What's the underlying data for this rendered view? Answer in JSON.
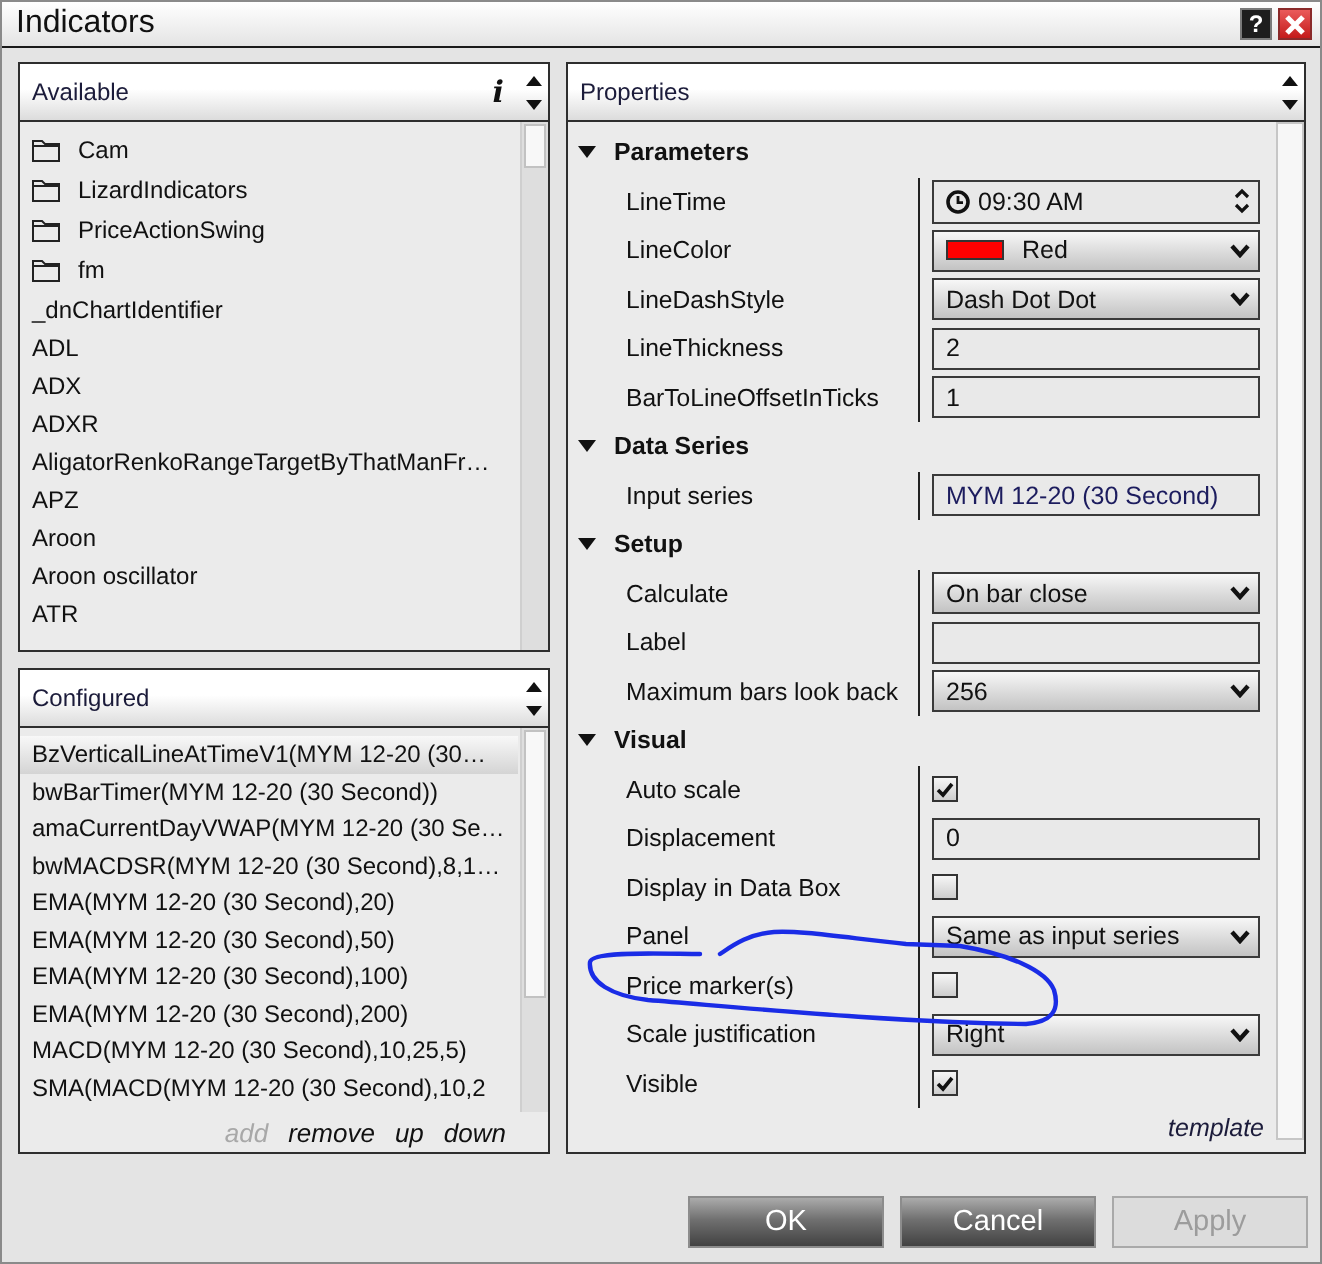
{
  "window": {
    "title": "Indicators",
    "help_button": "?"
  },
  "available": {
    "title": "Available",
    "info_button": "i",
    "items": [
      {
        "kind": "folder",
        "label": "Cam",
        "selected": false
      },
      {
        "kind": "folder",
        "label": "LizardIndicators",
        "selected": false
      },
      {
        "kind": "folder",
        "label": "PriceActionSwing",
        "selected": false
      },
      {
        "kind": "folder",
        "label": "fm",
        "selected": false
      },
      {
        "kind": "indicator",
        "label": "_dnChartIdentifier",
        "selected": false
      },
      {
        "kind": "indicator",
        "label": "ADL",
        "selected": false
      },
      {
        "kind": "indicator",
        "label": "ADX",
        "selected": false
      },
      {
        "kind": "indicator",
        "label": "ADXR",
        "selected": false
      },
      {
        "kind": "indicator",
        "label": "AligatorRenkoRangeTargetByThatManFr…",
        "selected": false
      },
      {
        "kind": "indicator",
        "label": "APZ",
        "selected": false
      },
      {
        "kind": "indicator",
        "label": "Aroon",
        "selected": false
      },
      {
        "kind": "indicator",
        "label": "Aroon oscillator",
        "selected": false
      },
      {
        "kind": "indicator",
        "label": "ATR",
        "selected": false
      }
    ]
  },
  "configured": {
    "title": "Configured",
    "items": [
      {
        "label": "BzVerticalLineAtTimeV1(MYM 12-20 (30…",
        "selected": true
      },
      {
        "label": "bwBarTimer(MYM 12-20 (30 Second))",
        "selected": false
      },
      {
        "label": "amaCurrentDayVWAP(MYM 12-20 (30 Se…",
        "selected": false
      },
      {
        "label": "bwMACDSR(MYM 12-20 (30 Second),8,1…",
        "selected": false
      },
      {
        "label": "EMA(MYM 12-20 (30 Second),20)",
        "selected": false
      },
      {
        "label": "EMA(MYM 12-20 (30 Second),50)",
        "selected": false
      },
      {
        "label": "EMA(MYM 12-20 (30 Second),100)",
        "selected": false
      },
      {
        "label": "EMA(MYM 12-20 (30 Second),200)",
        "selected": false
      },
      {
        "label": "MACD(MYM 12-20 (30 Second),10,25,5)",
        "selected": false
      },
      {
        "label": "SMA(MACD(MYM 12-20 (30 Second),10,2",
        "selected": false
      }
    ],
    "actions": [
      {
        "label": "add",
        "disabled": true
      },
      {
        "label": "remove",
        "disabled": false
      },
      {
        "label": "up",
        "disabled": false
      },
      {
        "label": "down",
        "disabled": false
      }
    ]
  },
  "properties": {
    "title": "Properties",
    "categories": [
      {
        "name": "Parameters",
        "expanded": true,
        "rows": [
          {
            "name": "LineTime",
            "kind": "time",
            "value": "09:30 AM",
            "circled": false
          },
          {
            "name": "LineColor",
            "kind": "color",
            "value": "Red",
            "color": "#ff0000",
            "circled": false
          },
          {
            "name": "LineDashStyle",
            "kind": "dropdown",
            "value": "Dash Dot Dot",
            "circled": false
          },
          {
            "name": "LineThickness",
            "kind": "text",
            "value": "2",
            "circled": false
          },
          {
            "name": "BarToLineOffsetInTicks",
            "kind": "text",
            "value": "1",
            "circled": false
          }
        ]
      },
      {
        "name": "Data Series",
        "expanded": true,
        "rows": [
          {
            "name": "Input series",
            "kind": "picker",
            "value": "MYM 12-20 (30 Second)",
            "circled": false
          }
        ]
      },
      {
        "name": "Setup",
        "expanded": true,
        "rows": [
          {
            "name": "Calculate",
            "kind": "dropdown",
            "value": "On bar close",
            "circled": false
          },
          {
            "name": "Label",
            "kind": "text",
            "circled": false
          },
          {
            "name": "Maximum bars look back",
            "kind": "dropdown",
            "value": "256",
            "circled": false
          }
        ]
      },
      {
        "name": "Visual",
        "expanded": true,
        "rows": [
          {
            "name": "Auto scale",
            "kind": "checkbox",
            "checked": true,
            "circled": false
          },
          {
            "name": "Displacement",
            "kind": "text",
            "value": "0",
            "circled": false
          },
          {
            "name": "Display in Data Box",
            "kind": "checkbox",
            "checked": false,
            "circled": false
          },
          {
            "name": "Panel",
            "kind": "dropdown",
            "value": "Same as input series",
            "circled": false
          },
          {
            "name": "Price marker(s)",
            "kind": "checkbox",
            "checked": false,
            "circled": true
          },
          {
            "name": "Scale justification",
            "kind": "dropdown",
            "value": "Right",
            "circled": false
          },
          {
            "name": "Visible",
            "kind": "checkbox",
            "checked": true,
            "circled": false
          }
        ]
      }
    ],
    "template_link": "template"
  },
  "buttons": [
    {
      "label": "OK",
      "disabled": false
    },
    {
      "label": "Cancel",
      "disabled": false
    },
    {
      "label": "Apply",
      "disabled": true
    }
  ]
}
